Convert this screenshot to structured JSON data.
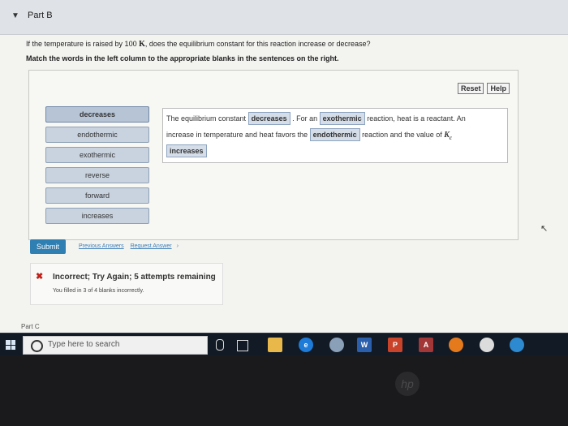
{
  "part_b": {
    "title": "Part B",
    "question_prefix": "If the temperature is raised by 100",
    "question_unit": "K",
    "question_suffix": ", does the equilibrium constant for this reaction increase or decrease?",
    "instruction": "Match the words in the left column to the appropriate blanks in the sentences on the right."
  },
  "panel": {
    "reset_label": "Reset",
    "help_label": "Help",
    "words": [
      "decreases",
      "endothermic",
      "exothermic",
      "reverse",
      "forward",
      "increases"
    ],
    "sentence": {
      "t1": "The equilibrium constant",
      "b1": "decreases",
      "t2": ". For an",
      "b2": "exothermic",
      "t3": "reaction, heat is a reactant. An",
      "t4": "increase in temperature and heat favors the",
      "b3": "endothermic",
      "t5": "reaction and the value of",
      "k_symbol": "K",
      "k_sub": "c",
      "b4": "increases"
    }
  },
  "actions": {
    "submit_label": "Submit",
    "previous_answers": "Previous Answers",
    "request_answer": "Request Answer",
    "chevron": "›"
  },
  "feedback": {
    "icon": "close-icon",
    "title": "Incorrect; Try Again; 5 attempts remaining",
    "subtitle": "You filled in 3 of 4 blanks incorrectly."
  },
  "part_c": {
    "title": "Part C"
  },
  "taskbar": {
    "search_placeholder": "Type here to search",
    "apps": [
      "file-explorer",
      "edge",
      "app",
      "word",
      "powerpoint",
      "access",
      "firefox",
      "chrome",
      "app2"
    ],
    "word_label": "W",
    "powerpoint_label": "P",
    "access_label": "A"
  },
  "device": {
    "logo": "hp"
  },
  "colors": {
    "submit": "#2f7fb3",
    "error": "#c0201a",
    "link": "#3d7fb8",
    "word_chip": "#c9d3df"
  }
}
